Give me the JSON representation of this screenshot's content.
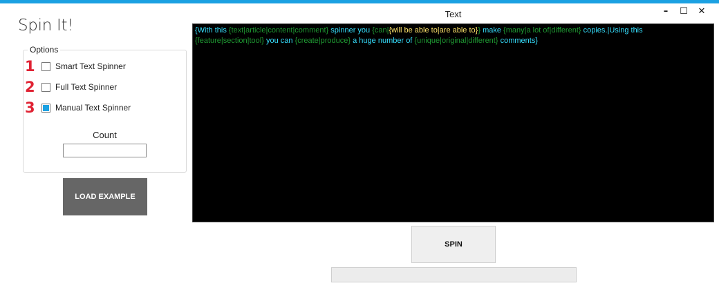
{
  "app": {
    "title": "Spin It!"
  },
  "window": {
    "minimize": "–",
    "maximize": "☐",
    "close": "✕"
  },
  "options": {
    "legend": "Options",
    "items": [
      {
        "number": "1",
        "label": "Smart Text Spinner",
        "checked": false
      },
      {
        "number": "2",
        "label": "Full Text Spinner",
        "checked": false
      },
      {
        "number": "3",
        "label": "Manual Text Spinner",
        "checked": true
      }
    ],
    "count_label": "Count",
    "count_value": ""
  },
  "load_example": {
    "label": "LOAD EXAMPLE"
  },
  "text_panel": {
    "header": "Text",
    "segments": [
      {
        "text": "{With this ",
        "color": "cyan"
      },
      {
        "text": "{text|article|content|comment}",
        "color": "green"
      },
      {
        "text": " spinner you ",
        "color": "cyan"
      },
      {
        "text": "{can|",
        "color": "green"
      },
      {
        "text": "{will be able to|are able to}",
        "color": "yellow"
      },
      {
        "text": "}",
        "color": "green"
      },
      {
        "text": " make ",
        "color": "cyan"
      },
      {
        "text": "{many|a lot of|different}",
        "color": "green"
      },
      {
        "text": " copies.|Using this ",
        "color": "cyan"
      },
      {
        "text": "{feature|section|tool}",
        "color": "green"
      },
      {
        "text": " you can ",
        "color": "cyan"
      },
      {
        "text": "{create|produce}",
        "color": "green"
      },
      {
        "text": " a huge number of ",
        "color": "cyan"
      },
      {
        "text": "{unique|original|different}",
        "color": "green"
      },
      {
        "text": " comments}",
        "color": "cyan"
      }
    ]
  },
  "spin": {
    "label": "SPIN"
  },
  "progress": {
    "value": 0
  },
  "colors": {
    "accent": "#1ba1e2",
    "cyan": "#36e0ff",
    "green": "#1f9b33",
    "yellow": "#ffe46b"
  }
}
